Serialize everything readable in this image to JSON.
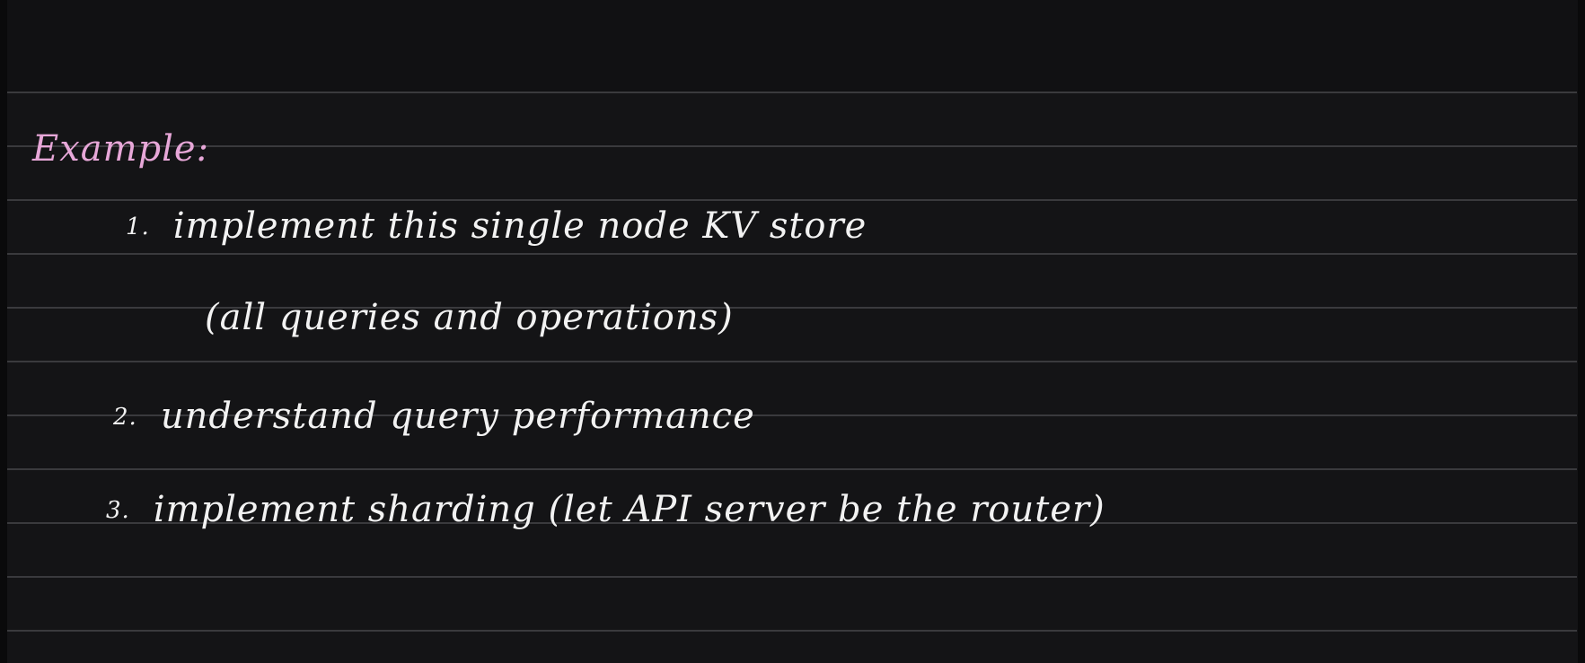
{
  "note": {
    "heading": "Example:",
    "items": [
      {
        "number": "1.",
        "text": "implement this single node KV store"
      },
      {
        "number": "",
        "text": "(all queries and operations)"
      },
      {
        "number": "2.",
        "text": "understand query performance"
      },
      {
        "number": "3.",
        "text": "implement sharding (let API server be the router)"
      }
    ]
  },
  "colors": {
    "background": "#141416",
    "rule": "#3a3a3d",
    "heading_ink": "#e7a7d8",
    "body_ink": "#f2f2f2"
  }
}
